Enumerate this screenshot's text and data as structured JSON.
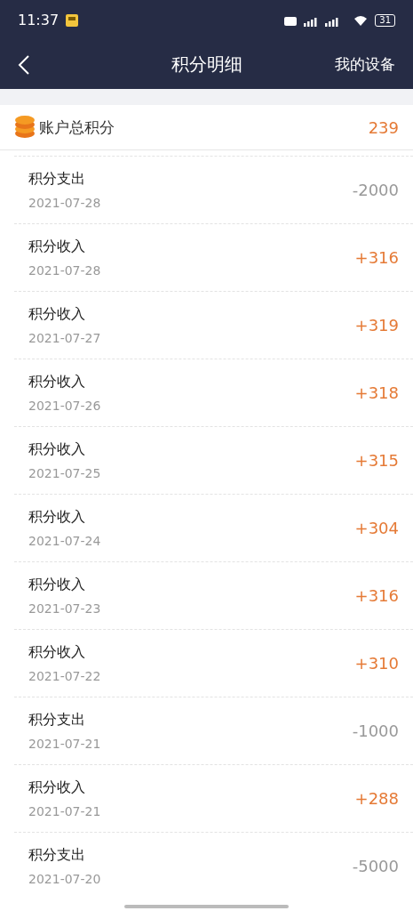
{
  "status_bar": {
    "time": "11:37",
    "battery": "31"
  },
  "nav": {
    "title": "积分明细",
    "action": "我的设备"
  },
  "total": {
    "label": "账户总积分",
    "value": "239"
  },
  "records": [
    {
      "title": "积分支出",
      "date": "2021-07-28",
      "amount": "-2000",
      "kind": "expense"
    },
    {
      "title": "积分收入",
      "date": "2021-07-28",
      "amount": "+316",
      "kind": "income"
    },
    {
      "title": "积分收入",
      "date": "2021-07-27",
      "amount": "+319",
      "kind": "income"
    },
    {
      "title": "积分收入",
      "date": "2021-07-26",
      "amount": "+318",
      "kind": "income"
    },
    {
      "title": "积分收入",
      "date": "2021-07-25",
      "amount": "+315",
      "kind": "income"
    },
    {
      "title": "积分收入",
      "date": "2021-07-24",
      "amount": "+304",
      "kind": "income"
    },
    {
      "title": "积分收入",
      "date": "2021-07-23",
      "amount": "+316",
      "kind": "income"
    },
    {
      "title": "积分收入",
      "date": "2021-07-22",
      "amount": "+310",
      "kind": "income"
    },
    {
      "title": "积分支出",
      "date": "2021-07-21",
      "amount": "-1000",
      "kind": "expense"
    },
    {
      "title": "积分收入",
      "date": "2021-07-21",
      "amount": "+288",
      "kind": "income"
    },
    {
      "title": "积分支出",
      "date": "2021-07-20",
      "amount": "-5000",
      "kind": "expense"
    }
  ]
}
